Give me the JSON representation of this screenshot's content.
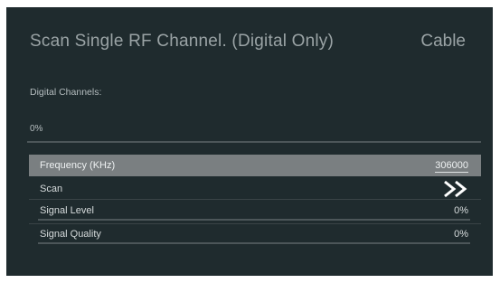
{
  "header": {
    "title": "Scan Single RF Channel. (Digital Only)",
    "source": "Cable"
  },
  "digital_channels": {
    "label": "Digital Channels:"
  },
  "progress": {
    "text": "0%",
    "value": 0
  },
  "menu": {
    "frequency": {
      "label": "Frequency (KHz)",
      "value": "306000"
    },
    "scan": {
      "label": "Scan",
      "icon": "double-chevron-right-icon"
    },
    "signal_level": {
      "label": "Signal Level",
      "text": "0%",
      "value": 0
    },
    "signal_quality": {
      "label": "Signal Quality",
      "text": "0%",
      "value": 0
    }
  },
  "colors": {
    "background": "#1f2b2e",
    "highlight_row": "#7a7f81",
    "text": "#d6dbdc"
  }
}
